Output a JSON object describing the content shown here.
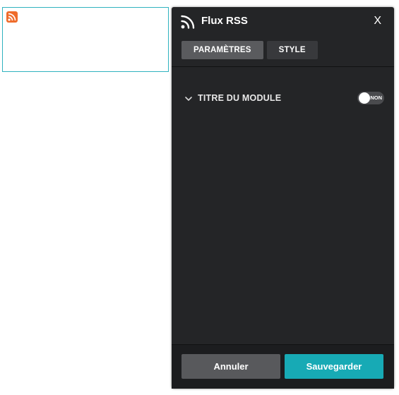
{
  "panel": {
    "title": "Flux RSS",
    "close_label": "X",
    "header_icon": "rss-icon"
  },
  "tabs": [
    {
      "label": "PARAMÈTRES",
      "active": true
    },
    {
      "label": "STYLE",
      "active": false
    }
  ],
  "section": {
    "label": "TITRE DU MODULE",
    "toggle_text": "NON",
    "toggle_on": false
  },
  "footer": {
    "cancel_label": "Annuler",
    "save_label": "Sauvegarder"
  },
  "preview": {
    "icon": "rss-feed-icon"
  },
  "colors": {
    "accent": "#17aab5",
    "panel_bg": "#242527",
    "rss_orange": "#ef6c2b",
    "preview_border": "#2fb2bf"
  }
}
